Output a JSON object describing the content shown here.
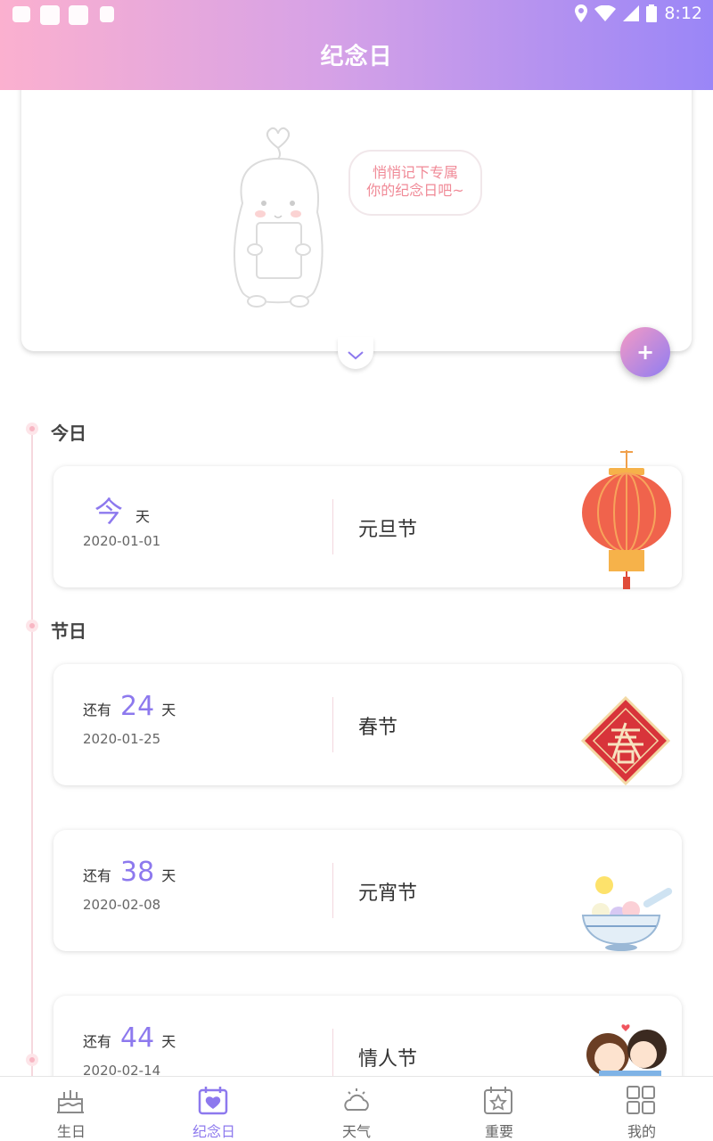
{
  "status_bar": {
    "time": "8:12"
  },
  "header": {
    "title": "纪念日"
  },
  "hero": {
    "bubble_line1": "悄悄记下专属",
    "bubble_line2": "你的纪念日吧~",
    "fab_label": "+"
  },
  "sections": [
    {
      "title": "今日"
    },
    {
      "title": "节日"
    }
  ],
  "today_card": {
    "big": "今",
    "unit": "天",
    "date": "2020-01-01",
    "name": "元旦节"
  },
  "holiday_cards": [
    {
      "prefix": "还有",
      "days": "24",
      "unit": "天",
      "date": "2020-01-25",
      "name": "春节"
    },
    {
      "prefix": "还有",
      "days": "38",
      "unit": "天",
      "date": "2020-02-08",
      "name": "元宵节"
    },
    {
      "prefix": "还有",
      "days": "44",
      "unit": "天",
      "date": "2020-02-14",
      "name": "情人节"
    }
  ],
  "tabs": [
    {
      "label": "生日",
      "icon": "cake-icon"
    },
    {
      "label": "纪念日",
      "icon": "calendar-heart-icon"
    },
    {
      "label": "天气",
      "icon": "weather-icon"
    },
    {
      "label": "重要",
      "icon": "calendar-star-icon"
    },
    {
      "label": "我的",
      "icon": "grid-icon"
    }
  ],
  "colors": {
    "accent": "#8d79ee",
    "header_start": "#fbb0cf",
    "header_end": "#9a86f7",
    "bubble_text": "#f08a97"
  }
}
